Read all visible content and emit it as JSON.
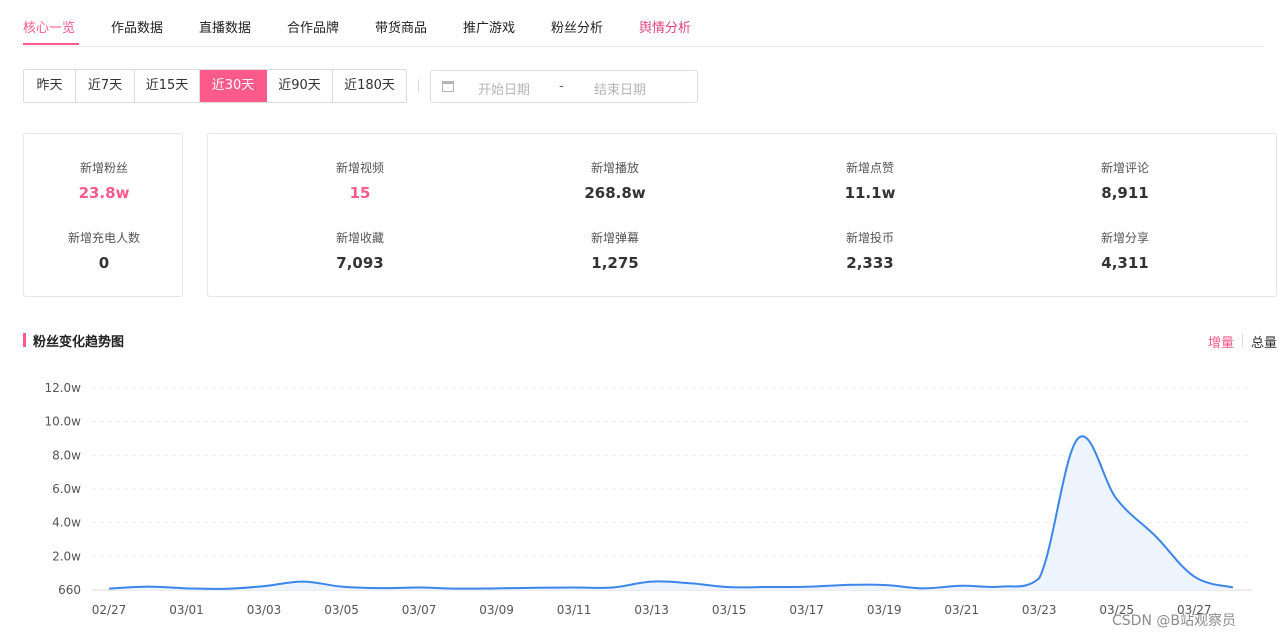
{
  "tabs": [
    "核心一览",
    "作品数据",
    "直播数据",
    "合作品牌",
    "带货商品",
    "推广游戏",
    "粉丝分析",
    "舆情分析"
  ],
  "active_tab": "核心一览",
  "range_buttons": [
    "昨天",
    "近7天",
    "近15天",
    "近30天",
    "近90天",
    "近180天"
  ],
  "active_range": "近30天",
  "date_picker": {
    "start_placeholder": "开始日期",
    "separator": "-",
    "end_placeholder": "结束日期",
    "icon": "calendar-icon"
  },
  "fans_card": {
    "items": [
      {
        "label": "新增粉丝",
        "value": "23.8w"
      },
      {
        "label": "新增充电人数",
        "value": "0"
      }
    ]
  },
  "metrics_card": {
    "items": [
      {
        "label": "新增视频",
        "value": "15"
      },
      {
        "label": "新增播放",
        "value": "268.8w"
      },
      {
        "label": "新增点赞",
        "value": "11.1w"
      },
      {
        "label": "新增评论",
        "value": "8,911"
      },
      {
        "label": "新增收藏",
        "value": "7,093"
      },
      {
        "label": "新增弹幕",
        "value": "1,275"
      },
      {
        "label": "新增投币",
        "value": "2,333"
      },
      {
        "label": "新增分享",
        "value": "4,311"
      }
    ]
  },
  "chart_section": {
    "title": "粉丝变化趋势图",
    "toggle": [
      "增量",
      "总量"
    ],
    "active_toggle": "增量"
  },
  "colors": {
    "accent": "#fb5a8a",
    "line": "#3b86e8",
    "area": "#eef4fd"
  },
  "chart_data": {
    "type": "area",
    "title": "",
    "xlabel": "",
    "ylabel": "",
    "y_ticks": [
      "660",
      "2.0w",
      "4.0w",
      "6.0w",
      "8.0w",
      "10.0w",
      "12.0w"
    ],
    "ylim": [
      0,
      120000
    ],
    "x_tick_labels": [
      "02/27",
      "03/01",
      "03/03",
      "03/05",
      "03/07",
      "03/09",
      "03/11",
      "03/13",
      "03/15",
      "03/17",
      "03/19",
      "03/21",
      "03/23",
      "03/25",
      "03/27"
    ],
    "x": [
      "02/27",
      "02/28",
      "03/01",
      "03/02",
      "03/03",
      "03/04",
      "03/05",
      "03/06",
      "03/07",
      "03/08",
      "03/09",
      "03/10",
      "03/11",
      "03/12",
      "03/13",
      "03/14",
      "03/15",
      "03/16",
      "03/17",
      "03/18",
      "03/19",
      "03/20",
      "03/21",
      "03/22",
      "03/23",
      "03/24",
      "03/25",
      "03/26",
      "03/27",
      "03/28"
    ],
    "series": [
      {
        "values": [
          800,
          2000,
          1000,
          700,
          2300,
          5000,
          2000,
          1100,
          1500,
          800,
          1000,
          1300,
          1500,
          1500,
          5000,
          4000,
          1700,
          1800,
          1900,
          3000,
          3000,
          1000,
          2500,
          2000,
          7000,
          90000,
          54000,
          32000,
          8000,
          1500
        ]
      }
    ],
    "grid": true,
    "legend": "none"
  },
  "watermark": "CSDN @B站观察员"
}
